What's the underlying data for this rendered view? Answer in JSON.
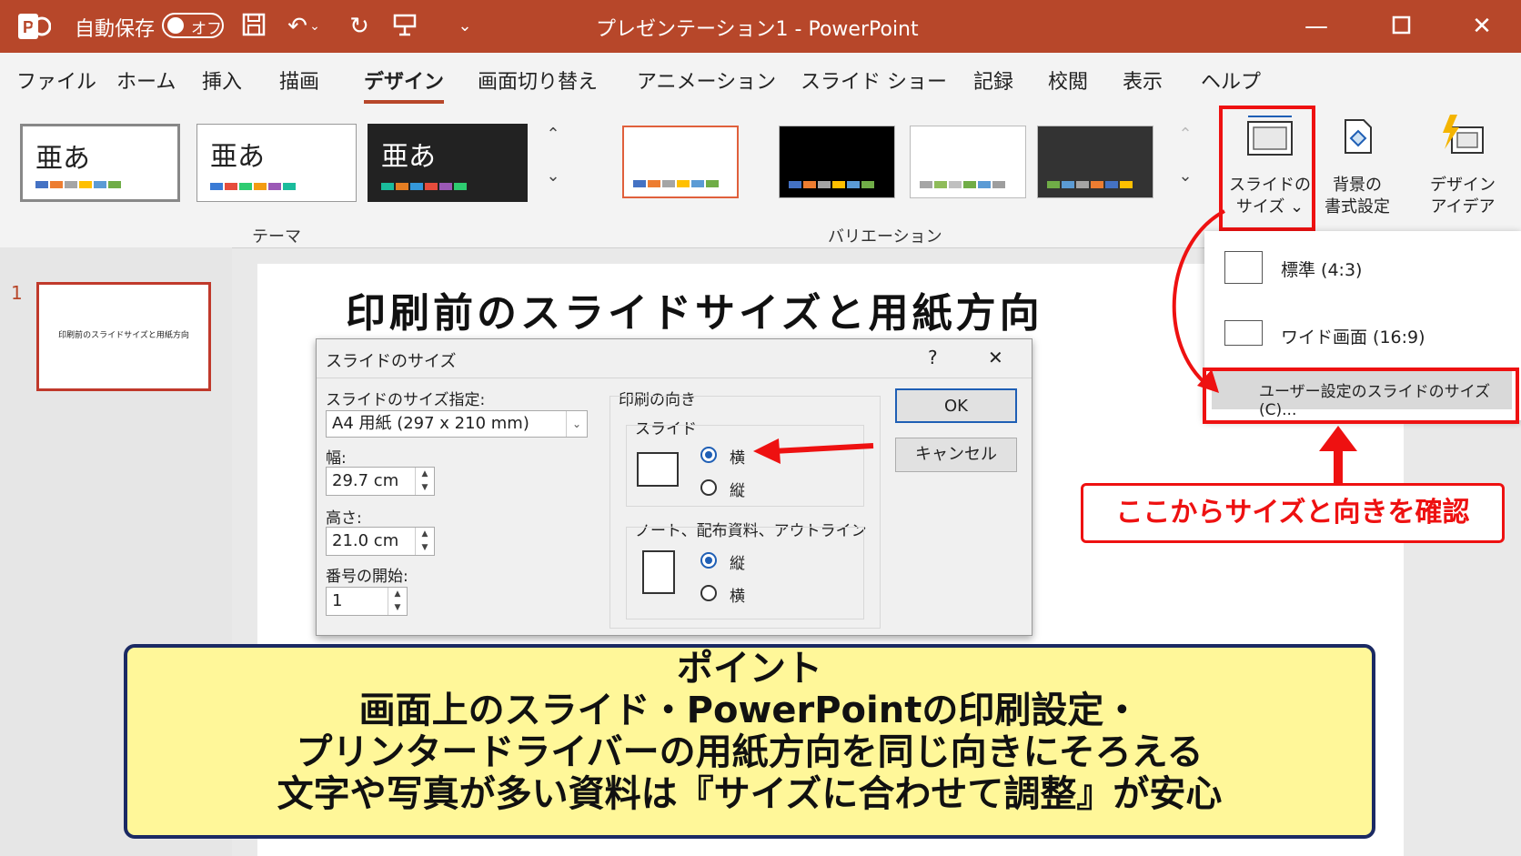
{
  "titlebar": {
    "autosave_label": "自動保存",
    "autosave_state": "オフ",
    "title": "プレゼンテーション1 - PowerPoint"
  },
  "menu": {
    "tabs": [
      "ファイル",
      "ホーム",
      "挿入",
      "描画",
      "デザイン",
      "画面切り替え",
      "アニメーション",
      "スライド ショー",
      "記録",
      "校閲",
      "表示",
      "ヘルプ"
    ],
    "active": "デザイン"
  },
  "ribbon": {
    "theme_sample": "亜あ",
    "theme_group": "テーマ",
    "variation_group": "バリエーション",
    "slide_size_line1": "スライドの",
    "slide_size_line2": "サイズ ⌄",
    "bg_line1": "背景の",
    "bg_line2": "書式設定",
    "design_line1": "デザイン",
    "design_line2": "アイデア",
    "colors": {
      "accent": "#b7472a"
    }
  },
  "slides": {
    "number": "1",
    "thumb_title": "印刷前のスライドサイズと用紙方向"
  },
  "slide_title": "印刷前のスライドサイズと用紙方向",
  "dialog": {
    "title": "スライドのサイズ",
    "help": "?",
    "close": "✕",
    "size_label": "スライドのサイズ指定:",
    "size_value": "A4 用紙 (297 x 210 mm)",
    "width_label": "幅:",
    "width_value": "29.7 cm",
    "height_label": "高さ:",
    "height_value": "21.0 cm",
    "start_label": "番号の開始:",
    "start_value": "1",
    "orientation_label": "印刷の向き",
    "slide_group": "スライド",
    "slide_landscape": "横",
    "slide_portrait": "縦",
    "notes_group": "ノート、配布資料、アウトライン",
    "notes_portrait": "縦",
    "notes_landscape": "横",
    "ok": "OK",
    "cancel": "キャンセル"
  },
  "dropdown": {
    "standard": "標準 (4:3)",
    "wide": "ワイド画面 (16:9)",
    "custom": "ユーザー設定のスライドのサイズ(C)..."
  },
  "callout": "ここからサイズと向きを確認",
  "point": {
    "lines": [
      "ポイント",
      "画面上のスライド・PowerPointの印刷設定・",
      "プリンタードライバーの用紙方向を同じ向きにそろえる",
      "文字や写真が多い資料は『サイズに合わせて調整』が安心"
    ]
  }
}
